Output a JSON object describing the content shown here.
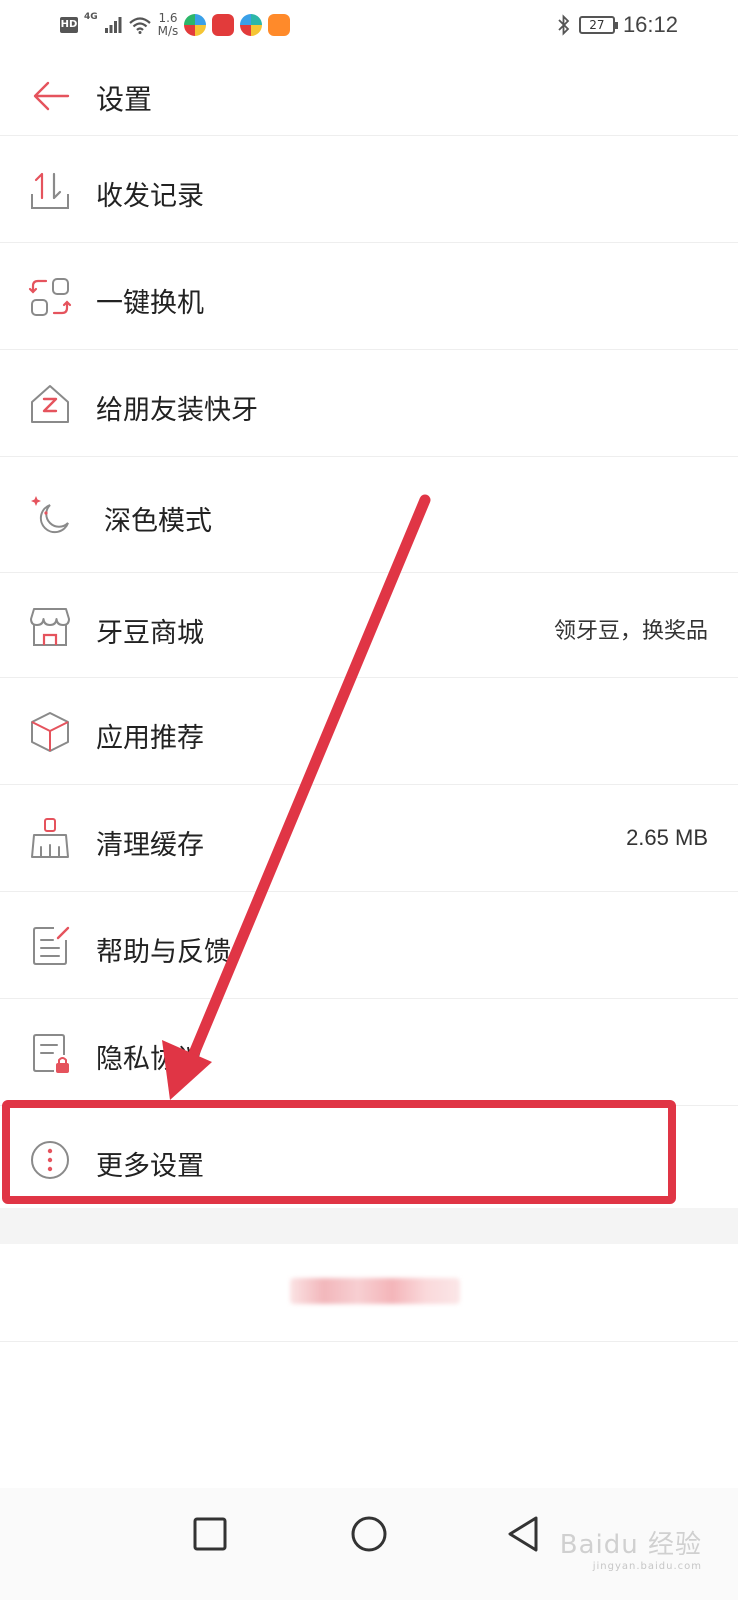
{
  "status_bar": {
    "hd": "HD",
    "network": "4G",
    "speed_value": "1.6",
    "speed_unit": "M/s",
    "battery": "27",
    "time": "16:12",
    "app_icon_colors": [
      "#3aa0e8",
      "#e23b3b",
      "#2cb6a8",
      "#ff8a2a"
    ]
  },
  "header": {
    "title": "设置",
    "back_icon": "back-arrow-icon"
  },
  "menu_items": [
    {
      "label": "收发记录",
      "value": "",
      "icon": "transfer-record-icon"
    },
    {
      "label": "一键换机",
      "value": "",
      "icon": "phone-switch-icon"
    },
    {
      "label": "给朋友装快牙",
      "value": "",
      "icon": "share-app-icon"
    },
    {
      "label": "深色模式",
      "value": "",
      "icon": "moon-icon"
    },
    {
      "label": "牙豆商城",
      "value": "领牙豆，换奖品",
      "icon": "store-icon"
    },
    {
      "label": "应用推荐",
      "value": "",
      "icon": "cube-icon"
    },
    {
      "label": "清理缓存",
      "value": "2.65 MB",
      "icon": "broom-icon"
    },
    {
      "label": "帮助与反馈",
      "value": "",
      "icon": "feedback-icon"
    },
    {
      "label": "隐私协议",
      "value": "",
      "icon": "privacy-icon"
    },
    {
      "label": "更多设置",
      "value": "",
      "icon": "more-dots-icon"
    }
  ],
  "colors": {
    "accent": "#e5535d",
    "annotation": "#e03545",
    "icon_gray": "#8a8a8a"
  },
  "watermark": {
    "text": "Baidu 经验",
    "sub": "jingyan.baidu.com"
  }
}
